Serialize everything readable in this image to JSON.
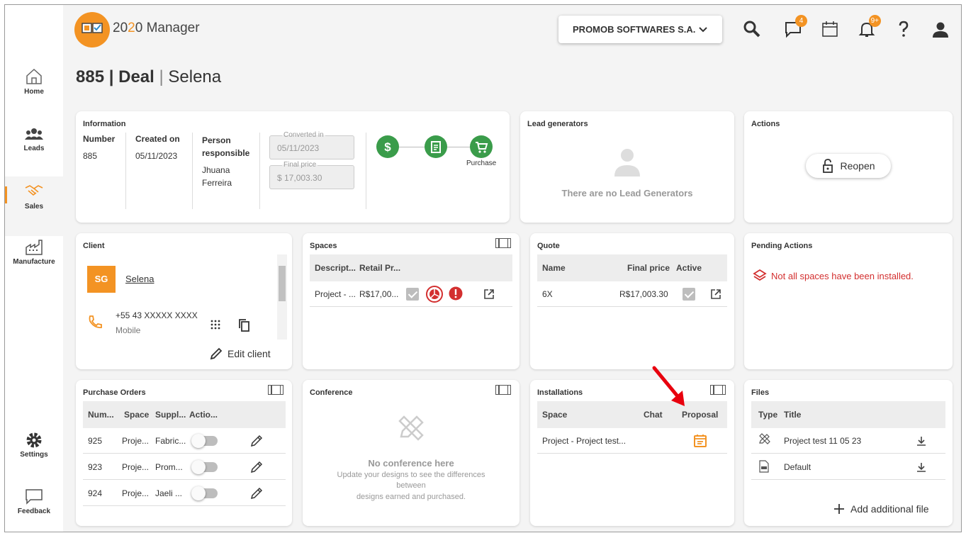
{
  "app": {
    "logo_text_a": "20",
    "logo_text_b": "2",
    "logo_text_c": "0 Manager",
    "company": "PROMOB SOFTWARES S.A.",
    "messages_count": "4",
    "notifications_count": "9+"
  },
  "nav": {
    "home": "Home",
    "leads": "Leads",
    "sales": "Sales",
    "manufacture": "Manufacture",
    "settings": "Settings",
    "feedback": "Feedback"
  },
  "title": {
    "number": "885",
    "kind": "Deal",
    "sep": "|",
    "client": "Selena"
  },
  "information": {
    "title": "Information",
    "number_label": "Number",
    "number": "885",
    "created_label": "Created on",
    "created": "05/11/2023",
    "person_label": "Person responsible",
    "person": "Jhuana Ferreira",
    "converted_label": "Converted in",
    "converted": "05/11/2023",
    "final_label": "Final price",
    "final": "$ 17,003.30",
    "stage_label": "Purchase"
  },
  "lead_generators": {
    "title": "Lead generators",
    "empty": "There are no Lead Generators"
  },
  "actions": {
    "title": "Actions",
    "reopen": "Reopen"
  },
  "client": {
    "title": "Client",
    "initials": "SG",
    "name": "Selena",
    "phone": "+55 43  XXXXX XXXX",
    "phone_type": "Mobile",
    "edit": "Edit client"
  },
  "spaces": {
    "title": "Spaces",
    "headers": [
      "Descript...",
      "Retail Pr..."
    ],
    "rows": [
      {
        "desc": "Project - ...",
        "price": "R$17,00..."
      }
    ]
  },
  "quote": {
    "title": "Quote",
    "headers": [
      "Name",
      "Final price",
      "Active"
    ],
    "rows": [
      {
        "name": "6X",
        "price": "R$17,003.30"
      }
    ]
  },
  "pending": {
    "title": "Pending Actions",
    "message": "Not all spaces have been installed."
  },
  "purchase_orders": {
    "title": "Purchase Orders",
    "headers": [
      "Num...",
      "Space",
      "Suppl...",
      "Actio..."
    ],
    "rows": [
      {
        "num": "925",
        "space": "Proje...",
        "supplier": "Fabric..."
      },
      {
        "num": "923",
        "space": "Proje...",
        "supplier": "Prom..."
      },
      {
        "num": "924",
        "space": "Proje...",
        "supplier": "Jaeli ..."
      }
    ]
  },
  "conference": {
    "title": "Conference",
    "empty_title": "No conference here",
    "empty_line1": "Update your designs to see the differences",
    "empty_line2": "between",
    "empty_line3": "designs earned and purchased."
  },
  "installations": {
    "title": "Installations",
    "headers": [
      "Space",
      "Chat",
      "Proposal"
    ],
    "rows": [
      {
        "space": "Project - Project test..."
      }
    ]
  },
  "files": {
    "title": "Files",
    "headers": [
      "Type",
      "Title"
    ],
    "rows": [
      {
        "title": "Project test 11 05 23"
      },
      {
        "title": "Default"
      }
    ],
    "add": "Add additional file"
  },
  "colors": {
    "accent": "#f39323",
    "success": "#3a9c4a",
    "danger": "#d32f2f",
    "annotation": "#e8000e"
  }
}
